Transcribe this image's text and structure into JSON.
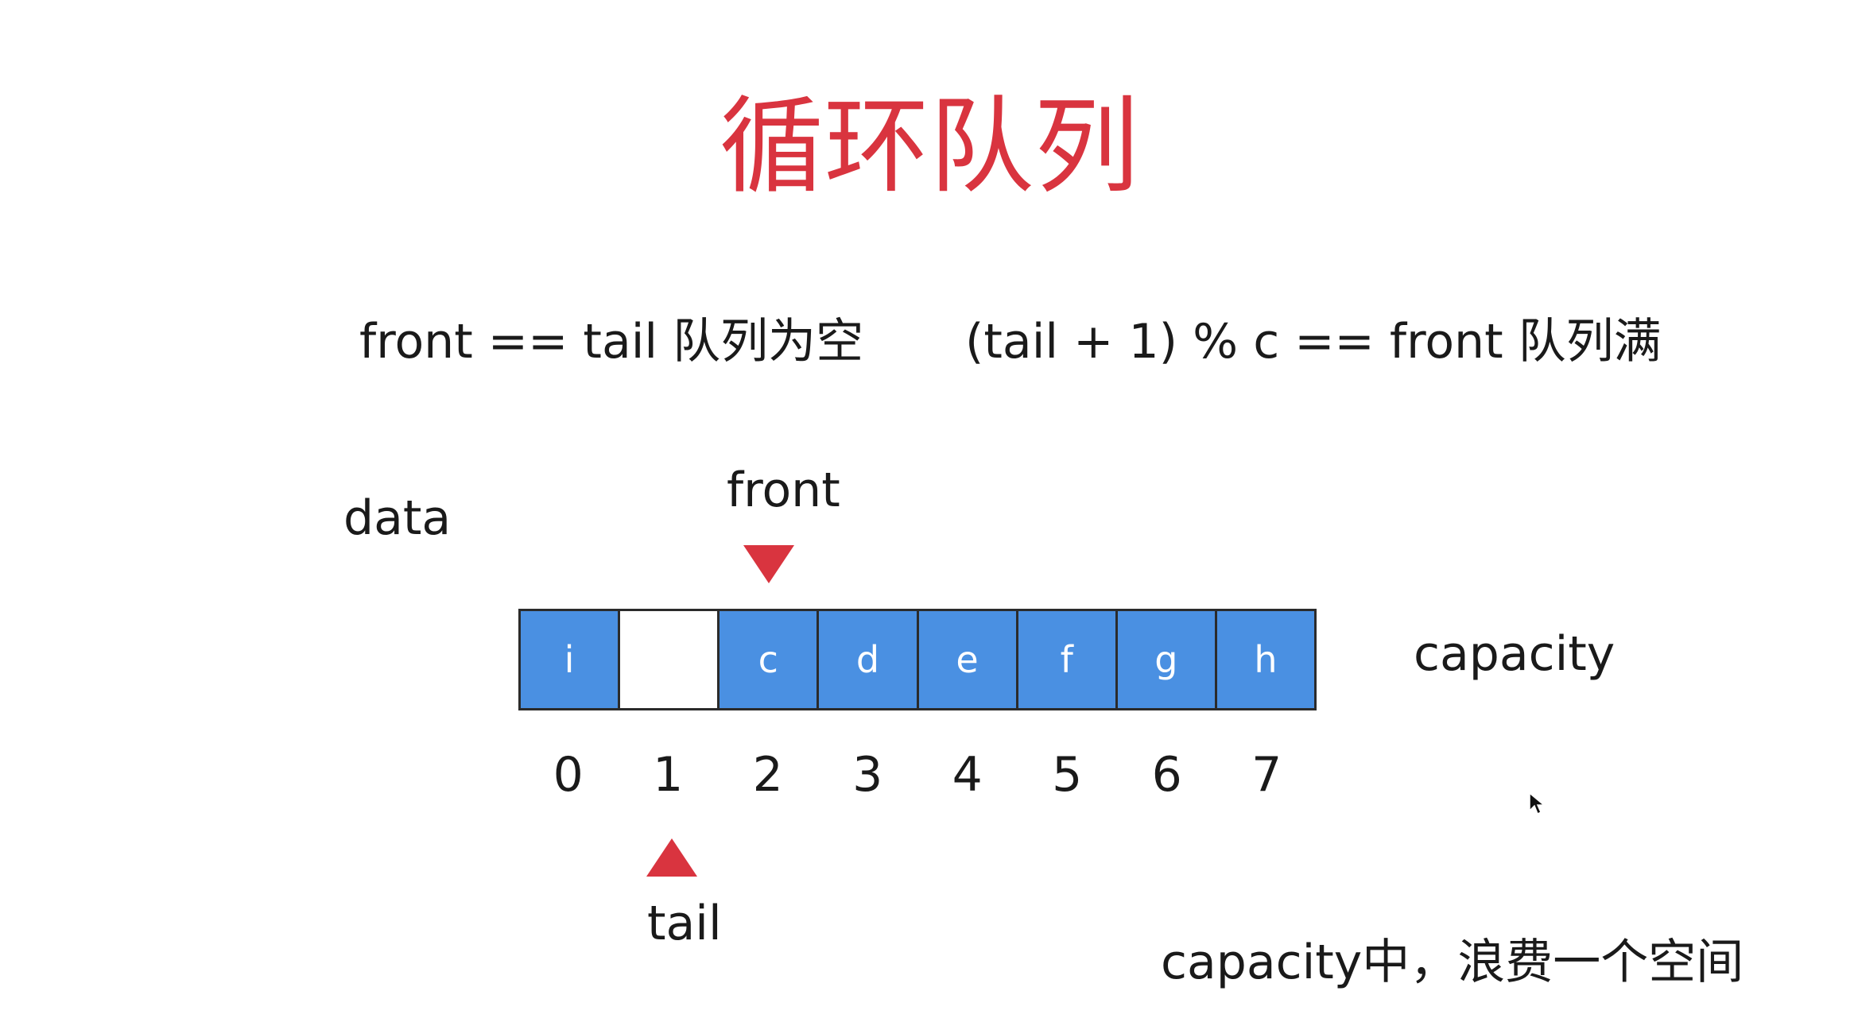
{
  "title": "循环队列",
  "conditions": {
    "empty": "front == tail 队列为空",
    "full": "(tail + 1) % c == front 队列满"
  },
  "labels": {
    "data": "data",
    "front": "front",
    "tail": "tail",
    "capacity": "capacity"
  },
  "cells": [
    "i",
    "",
    "c",
    "d",
    "e",
    "f",
    "g",
    "h"
  ],
  "indices": [
    "0",
    "1",
    "2",
    "3",
    "4",
    "5",
    "6",
    "7"
  ],
  "note": "capacity中，浪费一个空间",
  "colors": {
    "title": "#d9343f",
    "pointer": "#d9343f",
    "filled_cell": "#4a90e2",
    "empty_cell": "#ffffff"
  }
}
